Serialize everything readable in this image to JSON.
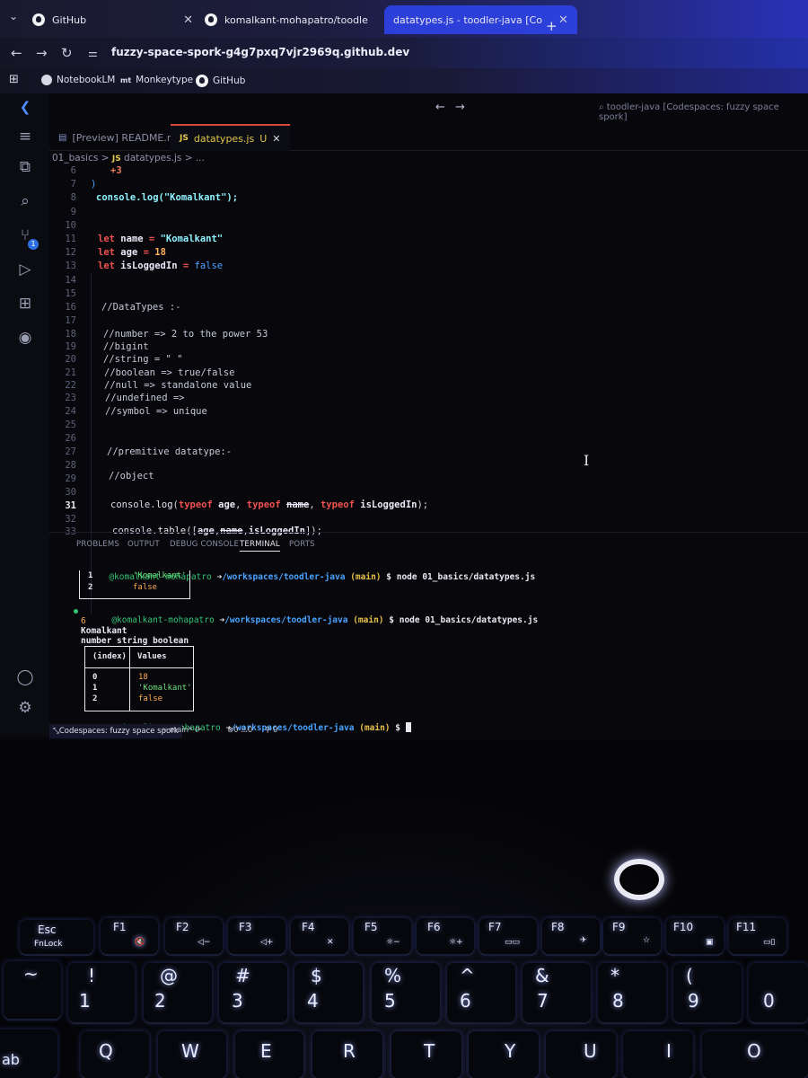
{
  "browser": {
    "tabs": [
      {
        "label": "GitHub",
        "icon": "github-icon"
      },
      {
        "label": "komalkant-mohapatro/toodle",
        "icon": "github-icon"
      },
      {
        "label": "datatypes.js - toodler-java [Co",
        "icon": "none"
      }
    ],
    "url": "fuzzy-space-spork-g4g7pxq7vjr2969q.github.dev",
    "bookmarks": [
      {
        "label": "NotebookLM"
      },
      {
        "label": "Monkeytype",
        "icon_text": "mt"
      },
      {
        "label": "GitHub"
      }
    ],
    "colors": {
      "accent": "#2d3fd9"
    }
  },
  "vscode": {
    "title_search": "toodler-java [Codespaces: fuzzy space spork]",
    "tabs": [
      {
        "label": "[Preview] README.md",
        "active": false
      },
      {
        "label": "datatypes.js",
        "badge": "U",
        "active": true
      }
    ],
    "breadcrumb": {
      "folder": "01_basics",
      "sep1": ">",
      "file": "datatypes.js",
      "sep2": "> ..."
    },
    "activity_badge": "1",
    "lines": [
      {
        "n": "6",
        "text": "+3"
      },
      {
        "n": "7",
        "text": ")"
      },
      {
        "n": "8",
        "text": "console.log(\"Komalkant\");"
      },
      {
        "n": "9",
        "text": ""
      },
      {
        "n": "10",
        "text": ""
      },
      {
        "n": "11",
        "kw": "let",
        "var": "name",
        "op": "=",
        "val": "\"Komalkant\""
      },
      {
        "n": "12",
        "kw": "let",
        "var": "age",
        "op": "=",
        "val": "18"
      },
      {
        "n": "13",
        "kw": "let",
        "var": "isLoggedIn",
        "op": "=",
        "val": "false"
      },
      {
        "n": "14",
        "text": ""
      },
      {
        "n": "15",
        "text": ""
      },
      {
        "n": "16",
        "text": "//DataTypes :-"
      },
      {
        "n": "17",
        "text": ""
      },
      {
        "n": "18",
        "text": "//number => 2 to the power 53"
      },
      {
        "n": "19",
        "text": "//bigint"
      },
      {
        "n": "20",
        "text": "//string = \" \""
      },
      {
        "n": "21",
        "text": "//boolean => true/false"
      },
      {
        "n": "22",
        "text": "//null => standalone value"
      },
      {
        "n": "23",
        "text": "//undefined =>"
      },
      {
        "n": "24",
        "text": "//symbol => unique"
      },
      {
        "n": "25",
        "text": ""
      },
      {
        "n": "26",
        "text": ""
      },
      {
        "n": "27",
        "text": "//premitive datatype:-"
      },
      {
        "n": "28",
        "text": ""
      },
      {
        "n": "29",
        "text": "//object"
      },
      {
        "n": "30",
        "text": ""
      },
      {
        "n": "31",
        "text": "console.log(typeof age, typeof name, typeof isLoggedIn);"
      },
      {
        "n": "32",
        "text": ""
      },
      {
        "n": "33",
        "text": "console.table([age,name,isLoggedIn]);"
      }
    ],
    "current_line": "31",
    "panel_tabs": [
      "PROBLEMS",
      "OUTPUT",
      "DEBUG CONSOLE",
      "TERMINAL",
      "PORTS"
    ],
    "terminal": {
      "user": "@komalkant-mohapatro",
      "arrow": "➜",
      "path": "/workspaces/toodler-java",
      "branch": "(main)",
      "prompt": "$",
      "cmd": "node 01_basics/datatypes.js",
      "prev_table": {
        "rows": [
          [
            "1",
            "'Komalkant'"
          ],
          [
            "2",
            "false"
          ]
        ]
      },
      "output_lines": [
        "6",
        "Komalkant",
        "number string boolean"
      ],
      "table": {
        "headers": [
          "(index)",
          "Values"
        ],
        "rows": [
          [
            "0",
            "18"
          ],
          [
            "1",
            "'Komalkant'"
          ],
          [
            "2",
            "false"
          ]
        ]
      }
    },
    "status": {
      "remote": "Codespaces: fuzzy space spork",
      "branch": "main*",
      "problems": "⊗0 ⚠0",
      "ports": "0"
    }
  },
  "keyboard": {
    "row1": [
      "Esc",
      "F1",
      "F2",
      "F3",
      "F4",
      "F5",
      "F6",
      "F7",
      "F8",
      "F9",
      "F10",
      "F11"
    ],
    "fnlock": "FnLock",
    "row2_top": [
      "~",
      "!",
      "@",
      "#",
      "$",
      "%",
      "^",
      "&",
      "*",
      "("
    ],
    "row2_bottom": [
      "",
      "1",
      "2",
      "3",
      "4",
      "5",
      "6",
      "7",
      "8",
      "9",
      "0"
    ],
    "row3": [
      "Q",
      "W",
      "E",
      "R",
      "T",
      "Y",
      "U",
      "I",
      "O"
    ],
    "tab_partial": "ab"
  }
}
